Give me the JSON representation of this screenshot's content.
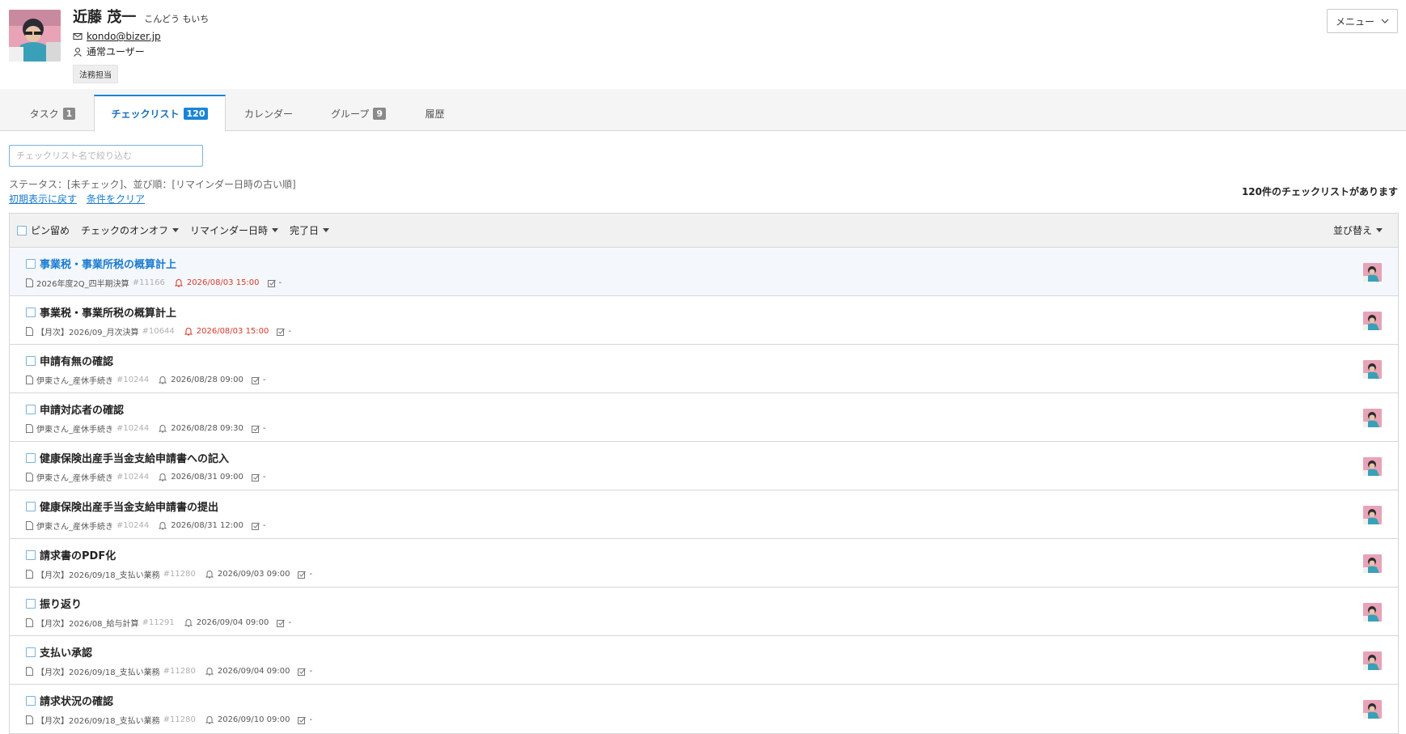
{
  "user": {
    "name": "近藤 茂一",
    "kana": "こんどう もいち",
    "email": "kondo@bizer.jp",
    "role": "通常ユーザー",
    "badge": "法務担当"
  },
  "header": {
    "menu_label": "メニュー"
  },
  "tabs": [
    {
      "label": "タスク",
      "count": "1"
    },
    {
      "label": "チェックリスト",
      "count": "120"
    },
    {
      "label": "カレンダー"
    },
    {
      "label": "グループ",
      "count": "9"
    },
    {
      "label": "履歴"
    }
  ],
  "filter": {
    "placeholder": "チェックリスト名で絞り込む",
    "status_text": "ステータス：[未チェック]、並び順：[リマインダー日時の古い順]",
    "reset_link": "初期表示に戻す",
    "clear_link": "条件をクリア",
    "result_count": "120件のチェックリストがあります"
  },
  "list_header": {
    "pin_label": "ピン留め",
    "check_toggle": "チェックのオンオフ",
    "reminder": "リマインダー日時",
    "completed": "完了日",
    "sort": "並び替え"
  },
  "rows": [
    {
      "title": "事業税・事業所税の概算計上",
      "project": "2026年度2Q_四半期決算",
      "id": "#11166",
      "reminder": "2026/08/03 15:00",
      "completed": "-"
    },
    {
      "title": "事業税・事業所税の概算計上",
      "project": "【月次】2026/09_月次決算",
      "id": "#10644",
      "reminder": "2026/08/03 15:00",
      "completed": "-"
    },
    {
      "title": "申請有無の確認",
      "project": "伊東さん_産休手続き",
      "id": "#10244",
      "reminder": "2026/08/28 09:00",
      "completed": "-"
    },
    {
      "title": "申請対応者の確認",
      "project": "伊東さん_産休手続き",
      "id": "#10244",
      "reminder": "2026/08/28 09:30",
      "completed": "-"
    },
    {
      "title": "健康保険出産手当金支給申請書への記入",
      "project": "伊東さん_産休手続き",
      "id": "#10244",
      "reminder": "2026/08/31 09:00",
      "completed": "-"
    },
    {
      "title": "健康保険出産手当金支給申請書の提出",
      "project": "伊東さん_産休手続き",
      "id": "#10244",
      "reminder": "2026/08/31 12:00",
      "completed": "-"
    },
    {
      "title": "請求書のPDF化",
      "project": "【月次】2026/09/18_支払い業務",
      "id": "#11280",
      "reminder": "2026/09/03 09:00",
      "completed": "-"
    },
    {
      "title": "振り返り",
      "project": "【月次】2026/08_給与計算",
      "id": "#11291",
      "reminder": "2026/09/04 09:00",
      "completed": "-"
    },
    {
      "title": "支払い承認",
      "project": "【月次】2026/09/18_支払い業務",
      "id": "#11280",
      "reminder": "2026/09/04 09:00",
      "completed": "-"
    },
    {
      "title": "請求状況の確認",
      "project": "【月次】2026/09/18_支払い業務",
      "id": "#11280",
      "reminder": "2026/09/10 09:00",
      "completed": "-"
    }
  ],
  "colors": {
    "accent": "#1a85d6",
    "link": "#1a7bd0",
    "alert": "#d9382b",
    "tab_count": "#8a8a8a"
  }
}
